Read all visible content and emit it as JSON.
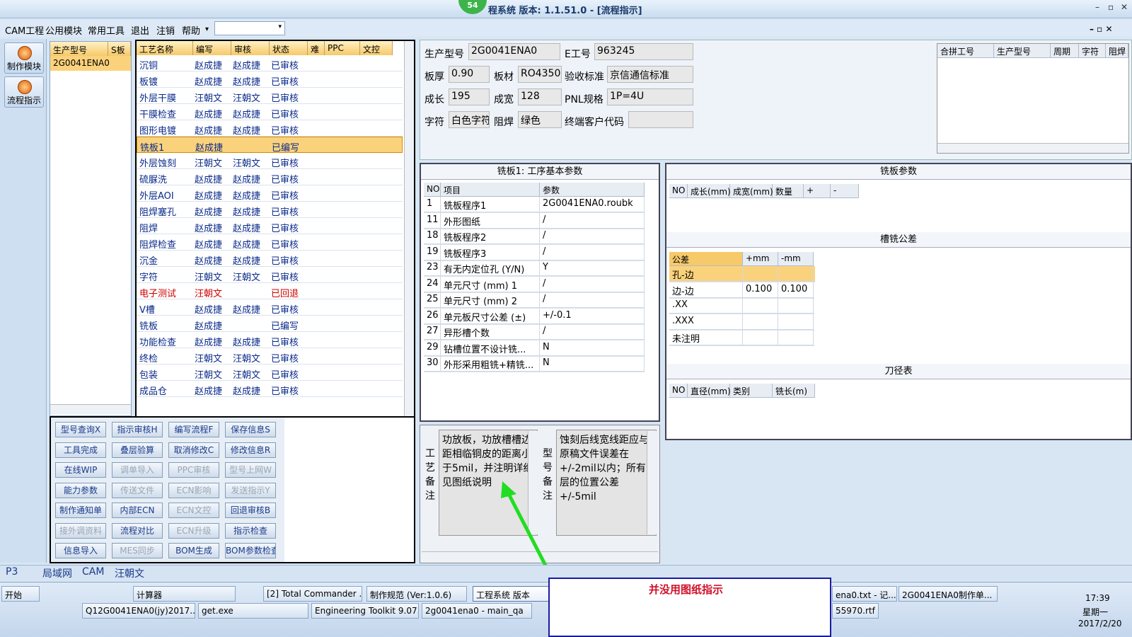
{
  "window": {
    "title": "程系统   版本: 1.1.51.0 - [流程指示]",
    "badge": "54",
    "minimize": "–",
    "restore": "▫",
    "close": "✕"
  },
  "menu": [
    "CAM工程",
    "公用模块",
    "常用工具",
    "退出",
    "注销",
    "帮助"
  ],
  "menu_dropdown_arrow": "▾",
  "combo_arrow": "▾",
  "mdi_controls": "– ▫ ✕",
  "leftnav": [
    {
      "label": "制作模块"
    },
    {
      "label": "流程指示"
    }
  ],
  "model_list": {
    "headers": [
      "生产型号",
      "S板"
    ],
    "items": [
      "2G0041ENA0"
    ]
  },
  "process": {
    "headers": [
      "工艺名称",
      "编写",
      "审核",
      "状态",
      "难",
      "PPC",
      "文控"
    ],
    "rows": [
      [
        "沉铜",
        "赵成捷",
        "赵成捷",
        "已审核"
      ],
      [
        "板镀",
        "赵成捷",
        "赵成捷",
        "已审核"
      ],
      [
        "外层干膜",
        "汪朝文",
        "汪朝文",
        "已审核"
      ],
      [
        "干膜检查",
        "赵成捷",
        "赵成捷",
        "已审核"
      ],
      [
        "图形电镀",
        "赵成捷",
        "赵成捷",
        "已审核"
      ],
      [
        "铣板1",
        "赵成捷",
        "",
        "已编写"
      ],
      [
        "外层蚀刻",
        "汪朝文",
        "汪朝文",
        "已审核"
      ],
      [
        "硫脲洗",
        "赵成捷",
        "赵成捷",
        "已审核"
      ],
      [
        "外层AOI",
        "赵成捷",
        "赵成捷",
        "已审核"
      ],
      [
        "阻焊塞孔",
        "赵成捷",
        "赵成捷",
        "已审核"
      ],
      [
        "阻焊",
        "赵成捷",
        "赵成捷",
        "已审核"
      ],
      [
        "阻焊检查",
        "赵成捷",
        "赵成捷",
        "已审核"
      ],
      [
        "沉金",
        "赵成捷",
        "赵成捷",
        "已审核"
      ],
      [
        "字符",
        "汪朝文",
        "汪朝文",
        "已审核"
      ],
      [
        "电子测试",
        "汪朝文",
        "",
        "已回退"
      ],
      [
        "V槽",
        "赵成捷",
        "赵成捷",
        "已审核"
      ],
      [
        "铣板",
        "赵成捷",
        "",
        "已编写"
      ],
      [
        "功能检查",
        "赵成捷",
        "赵成捷",
        "已审核"
      ],
      [
        "终检",
        "汪朝文",
        "汪朝文",
        "已审核"
      ],
      [
        "包装",
        "汪朝文",
        "汪朝文",
        "已审核"
      ],
      [
        "成品仓",
        "赵成捷",
        "赵成捷",
        "已审核"
      ]
    ]
  },
  "buttons": [
    [
      "型号查询X",
      "指示审核H",
      "编写流程F",
      "保存信息S"
    ],
    [
      "工具完成",
      "叠层验算",
      "取消修改C",
      "修改信息R"
    ],
    [
      "在线WIP",
      "调单导入",
      "PPC审核",
      "型号上网W"
    ],
    [
      "能力参数",
      "传送文件",
      "ECN影响",
      "发送指示Y"
    ],
    [
      "制作通知单",
      "内部ECN",
      "ECN文控",
      "回退审核B"
    ],
    [
      "接外调资料",
      "流程对比",
      "ECN升级",
      "指示检查"
    ],
    [
      "信息导入",
      "MES同步",
      "BOM生成",
      "BOM参数检查"
    ]
  ],
  "info": {
    "labels": {
      "model": "生产型号",
      "eno": "E工号",
      "thick": "板厚",
      "mat": "板材",
      "accept": "验收标准",
      "len": "成长",
      "wid": "成宽",
      "pnl": "PNL规格",
      "char": "字符",
      "mask": "阻焊",
      "cust": "终端客户代码"
    },
    "values": {
      "model": "2G0041ENA0",
      "eno": "963245",
      "thick": "0.90",
      "mat": "RO4350E",
      "accept": "京信通信标准",
      "len": "195",
      "wid": "128",
      "pnl": "1P=4U",
      "char": "白色字符",
      "mask": "绿色",
      "cust": ""
    }
  },
  "merge": {
    "headers": [
      "合拼工号",
      "生产型号",
      "周期",
      "字符",
      "阻焊"
    ]
  },
  "params": {
    "title": "铣板1: 工序基本参数",
    "headers": [
      "NO",
      "项目",
      "参数"
    ],
    "rows": [
      [
        "1",
        "铣板程序1",
        "2G0041ENA0.roubk"
      ],
      [
        "11",
        "外形图纸",
        "/"
      ],
      [
        "18",
        "铣板程序2",
        "/"
      ],
      [
        "19",
        "铣板程序3",
        "/"
      ],
      [
        "23",
        "有无内定位孔 (Y/N)",
        "Y"
      ],
      [
        "24",
        "单元尺寸 (mm) 1",
        "/"
      ],
      [
        "25",
        "单元尺寸 (mm) 2",
        "/"
      ],
      [
        "26",
        "单元板尺寸公差 (±)",
        "+/-0.1"
      ],
      [
        "27",
        "异形槽个数",
        "/"
      ],
      [
        "29",
        "钻槽位置不设计铣...",
        "N"
      ],
      [
        "30",
        "外形采用粗铣+精铣...",
        "N"
      ]
    ]
  },
  "mill": {
    "title": "铣板参数",
    "headers": [
      "NO",
      "成长(mm)",
      "成宽(mm)",
      "数量",
      "+",
      "-"
    ]
  },
  "tol": {
    "title": "槽铣公差",
    "headers": [
      "公差",
      "+mm",
      "-mm"
    ],
    "rows": [
      [
        "孔-边",
        "",
        ""
      ],
      [
        "边-边",
        "0.100",
        "0.100"
      ],
      [
        ".XX",
        "",
        ""
      ],
      [
        ".XXX",
        "",
        ""
      ],
      [
        "未注明",
        "",
        ""
      ]
    ]
  },
  "tool": {
    "title": "刀径表",
    "headers": [
      "NO",
      "直径(mm)",
      "类别",
      "铣长(m)"
    ]
  },
  "remarks": {
    "proc_label": "工艺备注",
    "proc_text": "功放板，功放槽槽边距相临铜皮的距离小于5mil，并注明详细见图纸说明",
    "model_label": "型号备注",
    "model_text": "蚀刻后线宽线距应与原稿文件误差在+/-2mil以内；所有层的位置公差+/-5mil"
  },
  "tabs": [
    "P3",
    "局域网",
    "CAM",
    "汪朝文"
  ],
  "taskbar": {
    "start": "开始",
    "row1": [
      "计算器",
      "[2] Total Commander ...",
      "制作规范 (Ver:1.0.6)",
      "工程系统  版本",
      "ena0.txt - 记...",
      "2G0041ENA0制作单..."
    ],
    "row2": [
      "Q12G0041ENA0(jy)2017...",
      "get.exe",
      "Engineering Toolkit 9.07...",
      "2g0041ena0 - main_qa",
      "55970.rtf [..."
    ],
    "time": "17:39",
    "day": "星期一",
    "date": "2017/2/20"
  },
  "annotation": {
    "text": "并没用图纸指示",
    "color": "#d0102a"
  }
}
